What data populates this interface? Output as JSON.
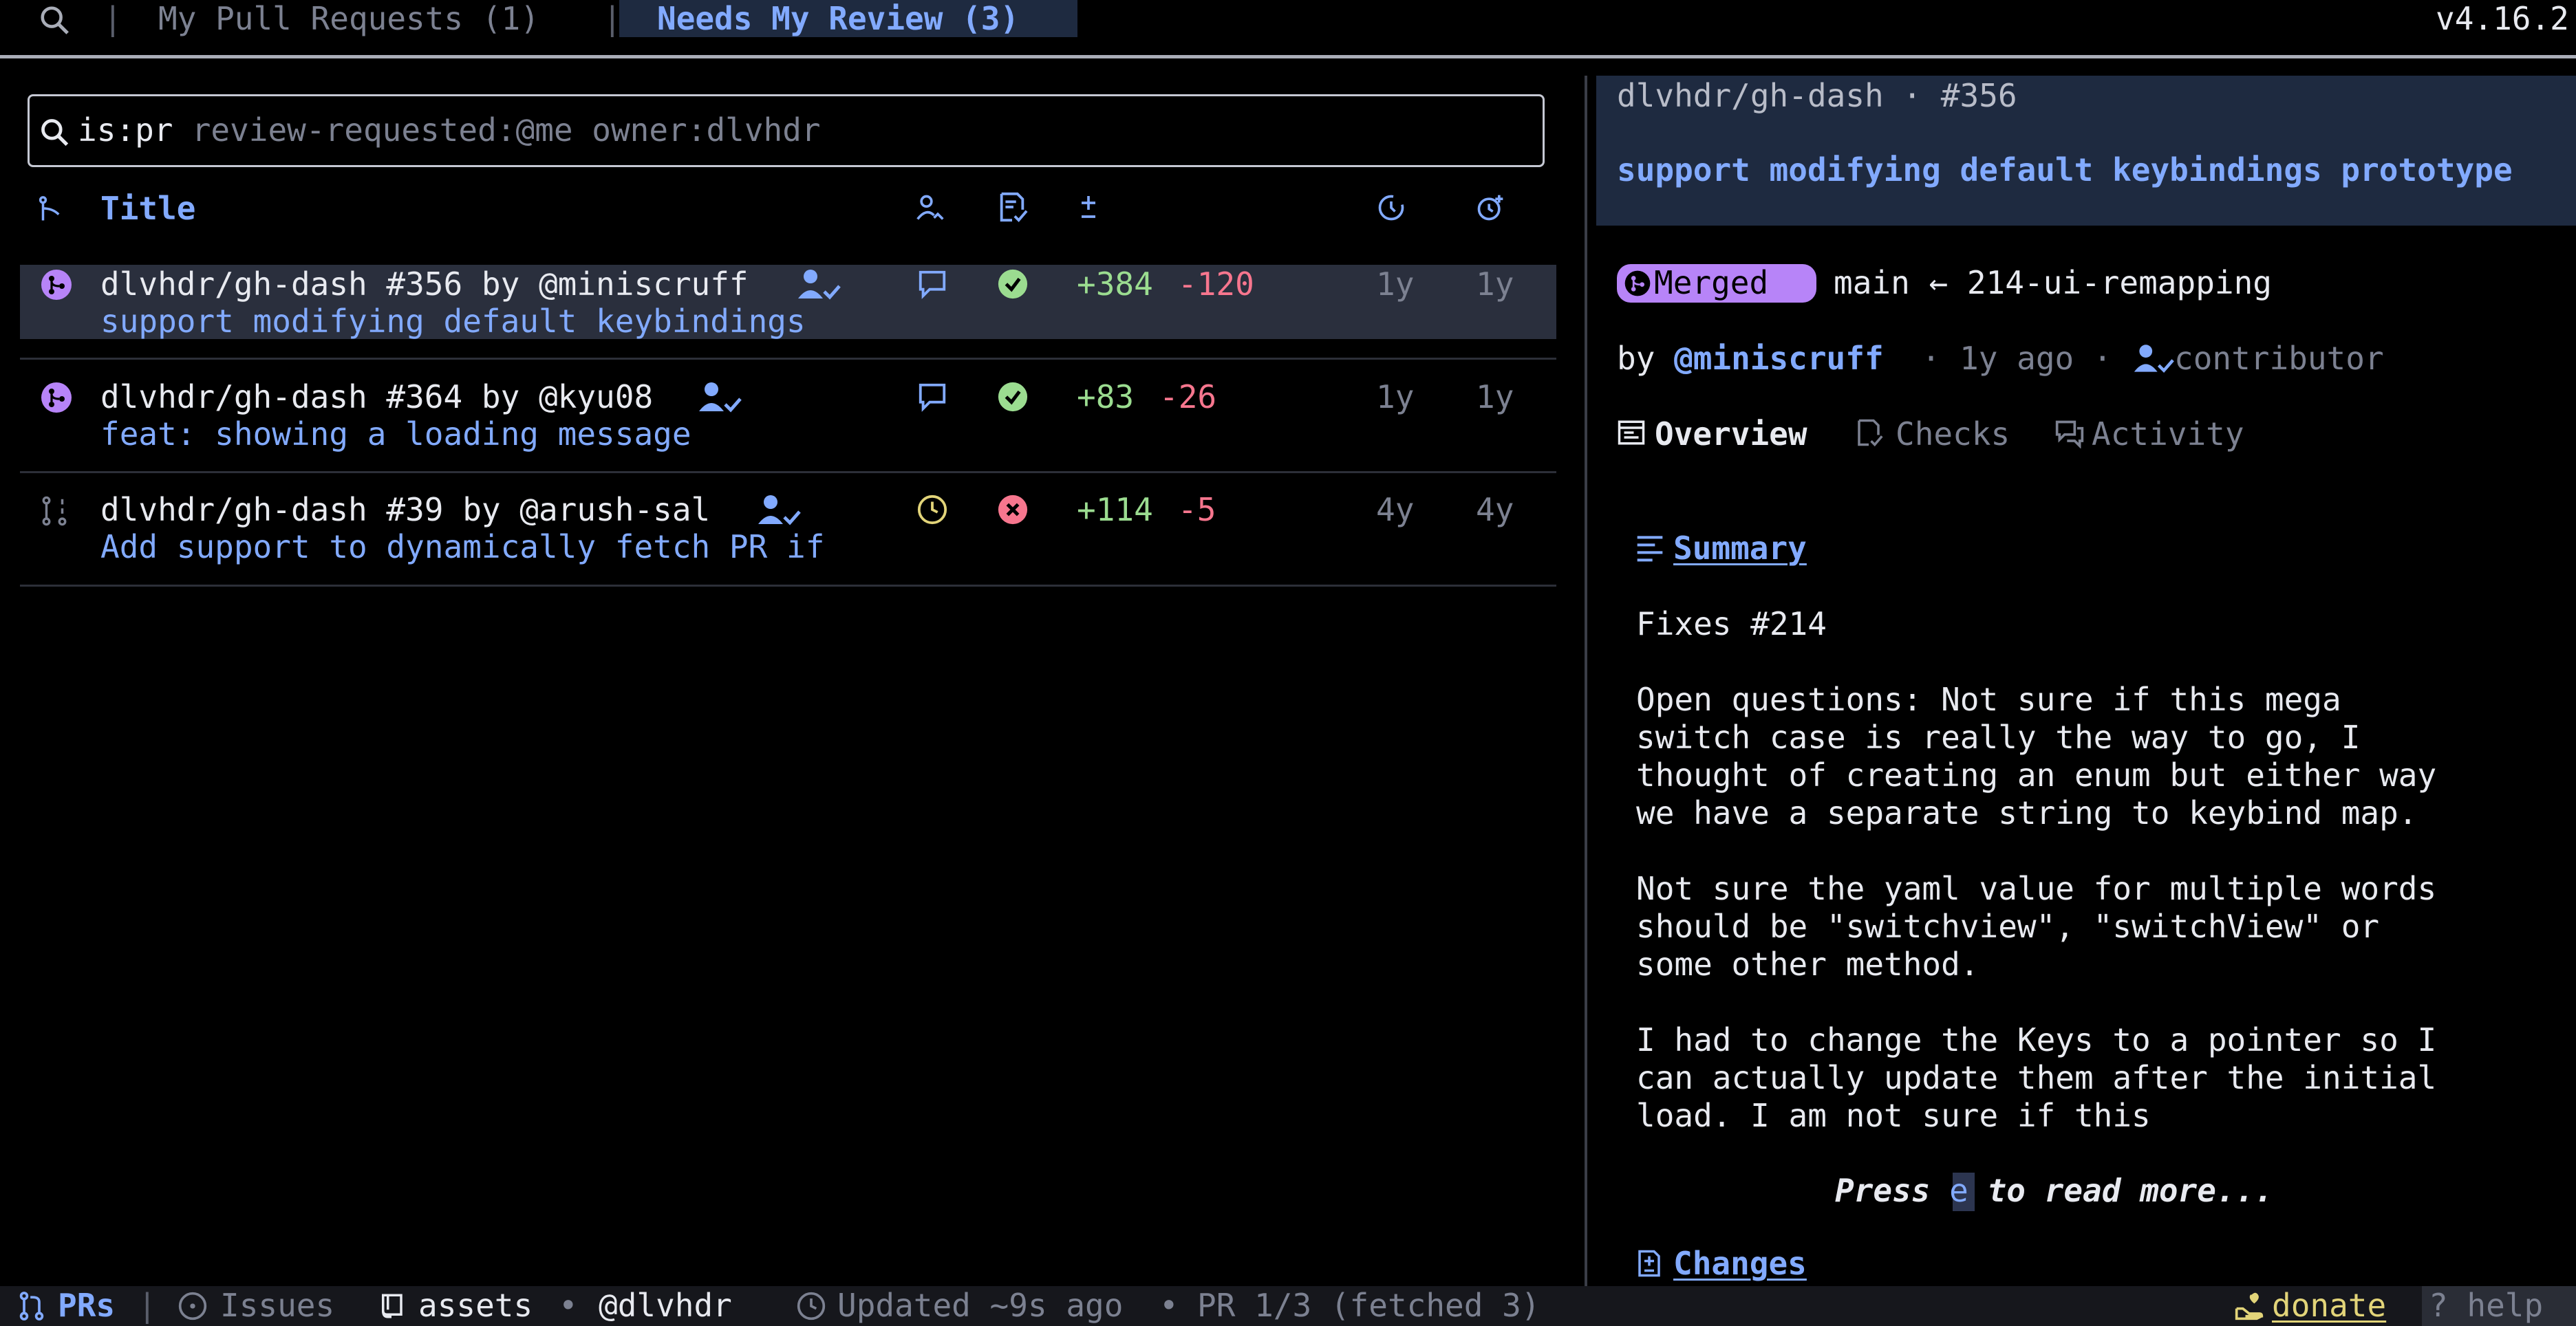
{
  "tabbar": {
    "tabs": [
      {
        "label": "My Pull Requests (1)"
      },
      {
        "label": "Needs My Review (3)"
      }
    ],
    "version": "v4.16.2"
  },
  "search": {
    "prefix": "is:pr",
    "query": " review-requested:@me owner:dlvhdr"
  },
  "table": {
    "header": {
      "title": "Title"
    },
    "rows": [
      {
        "repo_line": "dlvhdr/gh-dash #356 by @miniscruff",
        "title": "support modifying default keybindings",
        "state": "merged",
        "ci": "success",
        "additions": "+384",
        "deletions": "-120",
        "updated": "1y",
        "created": "1y"
      },
      {
        "repo_line": "dlvhdr/gh-dash #364 by @kyu08",
        "title": "feat: showing a loading message",
        "state": "merged",
        "ci": "success",
        "additions": "+83",
        "deletions": "-26",
        "updated": "1y",
        "created": "1y"
      },
      {
        "repo_line": "dlvhdr/gh-dash #39 by @arush-sal",
        "title": "Add support to dynamically fetch PR if",
        "state": "draft",
        "ci": "failure",
        "additions": "+114",
        "deletions": "-5",
        "updated": "4y",
        "created": "4y"
      }
    ]
  },
  "detail": {
    "repo": "dlvhdr/gh-dash · #356",
    "title": "support modifying default keybindings prototype",
    "state_label": "Merged",
    "branches": "main ← 214-ui-remapping",
    "by": "by ",
    "author": "@miniscruff",
    "ago": " · 1y ago · ",
    "role": "contributor",
    "tabs": [
      "Overview",
      "Checks",
      "Activity"
    ],
    "summary_heading": "Summary",
    "body_lines": [
      "Fixes #214",
      "",
      "Open questions: Not sure if this mega",
      "switch case is really the way to go, I",
      "thought of creating an enum but either way",
      "we have a separate string to keybind map.",
      "",
      "Not sure the yaml value for multiple words",
      "should be \"switchview\", \"switchView\" or",
      "some other method.",
      "",
      "I had to change the Keys to a pointer so I",
      "can actually update them after the initial",
      "load. I am not sure if this"
    ],
    "read_more_pre": "Press ",
    "read_more_key": "e",
    "read_more_post": " to read more...",
    "changes_heading": "Changes"
  },
  "statusbar": {
    "prs": "PRs",
    "issues": "Issues",
    "repo": "assets",
    "user": "@dlvhdr",
    "updated": "Updated ~9s ago",
    "pr_count": "PR 1/3 (fetched 3)",
    "donate": "donate",
    "help": "? help"
  },
  "colors": {
    "accent": "#82aaff",
    "merged": "#b784f8",
    "success": "#9bdc90",
    "failure": "#f7768e",
    "pending": "#e2d479"
  }
}
